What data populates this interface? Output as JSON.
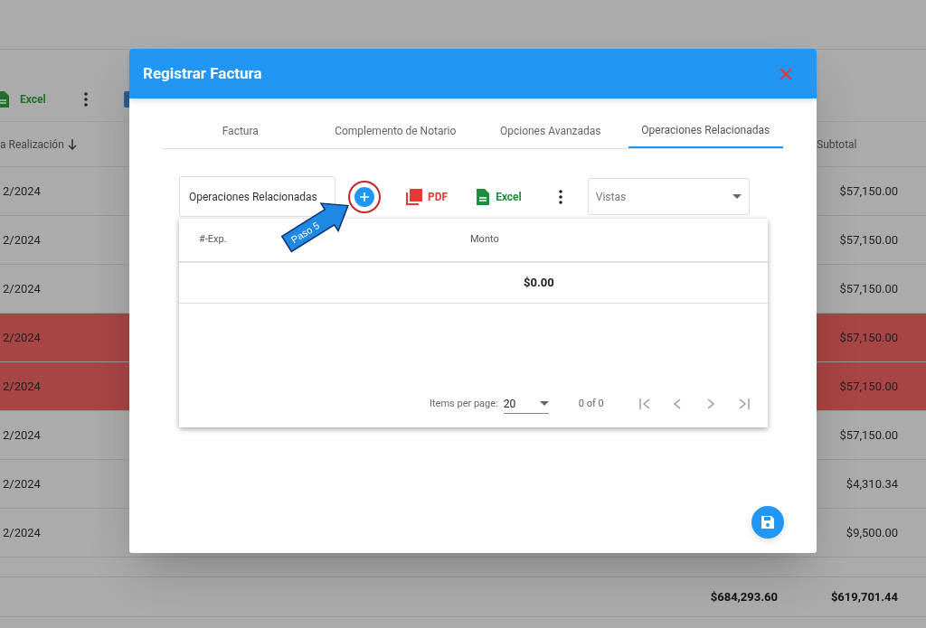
{
  "background": {
    "toolbar": {
      "excel_label": "Excel"
    },
    "columns": [
      {
        "label": "a Realización",
        "sorted": true
      },
      {
        "label": "Subtotal",
        "sorted": false
      }
    ],
    "rows": [
      {
        "column_1": "2/2024",
        "subtotal": "$57,150.00",
        "highlighted": false
      },
      {
        "column_1": "2/2024",
        "subtotal": "$57,150.00",
        "highlighted": false
      },
      {
        "column_1": "2/2024",
        "subtotal": "$57,150.00",
        "highlighted": false
      },
      {
        "column_1": "2/2024",
        "subtotal": "$57,150.00",
        "highlighted": true
      },
      {
        "column_1": "2/2024",
        "subtotal": "$57,150.00",
        "highlighted": true
      },
      {
        "column_1": "2/2024",
        "subtotal": "$57,150.00",
        "highlighted": false
      },
      {
        "column_1": "2/2024",
        "subtotal": "$4,310.34",
        "highlighted": false
      },
      {
        "column_1": "2/2024",
        "subtotal": "$9,500.00",
        "highlighted": false
      }
    ],
    "totals": [
      "$684,293.60",
      "$619,701.44"
    ]
  },
  "dialog": {
    "title": "Registrar Factura",
    "tabs": [
      {
        "label": "Factura",
        "selected": false
      },
      {
        "label": "Complemento de Notario",
        "selected": false
      },
      {
        "label": "Opciones Avanzadas",
        "selected": false
      },
      {
        "label": "Operaciones Relacionadas",
        "selected": true
      }
    ],
    "toolbar": {
      "view_name": "Operaciones Relacionadas",
      "pdf_label": "PDF",
      "excel_label": "Excel",
      "views_placeholder": "Vistas"
    },
    "callout": "Paso 5",
    "table": {
      "columns": [
        "#-Exp.",
        "Monto"
      ],
      "total": "$0.00"
    },
    "paginator": {
      "items_label": "Items per page:",
      "page_size": "20",
      "range": "0 of 0"
    }
  }
}
